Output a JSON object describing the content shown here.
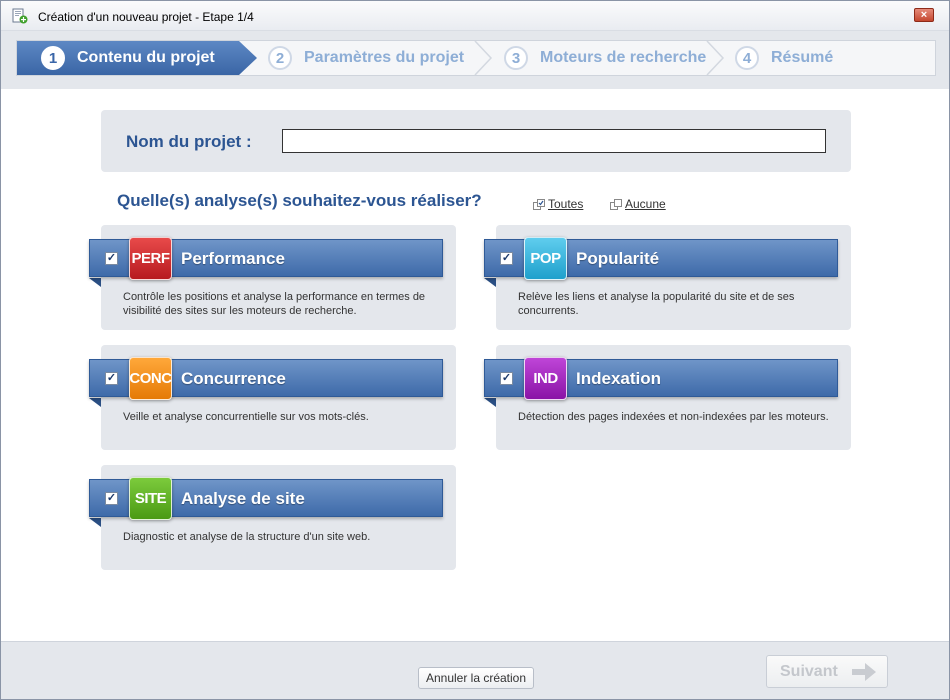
{
  "window": {
    "title": "Création d'un nouveau projet - Etape 1/4",
    "close_label": "×"
  },
  "wizard": {
    "steps": [
      {
        "num": "1",
        "label": "Contenu du projet",
        "active": true
      },
      {
        "num": "2",
        "label": "Paramètres du projet",
        "active": false
      },
      {
        "num": "3",
        "label": "Moteurs de recherche",
        "active": false
      },
      {
        "num": "4",
        "label": "Résumé",
        "active": false
      }
    ]
  },
  "project": {
    "name_label": "Nom du projet :",
    "name_value": ""
  },
  "analyses": {
    "question": "Quelle(s) analyse(s) souhaitez-vous réaliser?",
    "select_all_label": "Toutes",
    "select_none_label": "Aucune",
    "items": [
      {
        "badge": "PERF",
        "badge_color": "#d4202a",
        "title": "Performance",
        "checked": true,
        "description": "Contrôle les positions et analyse la performance en termes de visibilité des sites sur les moteurs de recherche."
      },
      {
        "badge": "POP",
        "badge_color": "#2fb4dc",
        "title": "Popularité",
        "checked": true,
        "description": "Relève les liens et analyse la popularité du site et de ses concurrents."
      },
      {
        "badge": "CONC",
        "badge_color": "#f08a12",
        "title": "Concurrence",
        "checked": true,
        "description": "Veille et analyse concurrentielle sur vos mots-clés."
      },
      {
        "badge": "IND",
        "badge_color": "#9b1fb8",
        "title": "Indexation",
        "checked": true,
        "description": "Détection des pages indexées et non-indexées par les moteurs."
      },
      {
        "badge": "SITE",
        "badge_color": "#5aaa1e",
        "title": "Analyse de site",
        "checked": true,
        "description": "Diagnostic et analyse de la structure d'un site web."
      }
    ]
  },
  "footer": {
    "cancel_label": "Annuler la création",
    "next_label": "Suivant"
  },
  "colors": {
    "accent": "#3e6aa9",
    "heading": "#2c5592"
  }
}
